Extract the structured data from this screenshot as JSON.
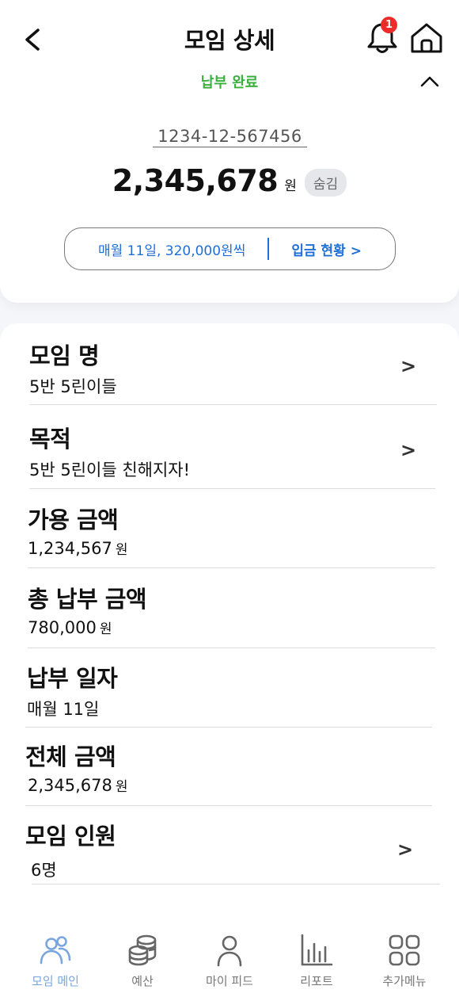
{
  "header": {
    "title": "모임 상세",
    "notification_count": "1",
    "status": "납부 완료"
  },
  "account": {
    "number": "1234-12-567456",
    "balance": "2,345,678",
    "unit": "원",
    "hide_label": "숨김"
  },
  "deposit": {
    "schedule": "매월 11일,  320,000원씩",
    "link_label": "입금 현황  >"
  },
  "info": {
    "group_name": {
      "title": "모임 명",
      "value": "5반 5린이들"
    },
    "purpose": {
      "title": "목적",
      "value": "5반 5린이들 친해지자!"
    },
    "available": {
      "title": "가용 금액",
      "value": "1,234,567",
      "unit": "원"
    },
    "total_paid": {
      "title": "총 납부 금액",
      "value": "780,000",
      "unit": "원"
    },
    "pay_date": {
      "title": "납부 일자",
      "value": "매월 11일"
    },
    "total": {
      "title": "전체 금액",
      "value": "2,345,678",
      "unit": "원"
    },
    "members": {
      "title": "모임 인원",
      "value": "6명"
    },
    "arrow": ">"
  },
  "nav": {
    "items": [
      {
        "label": "모임 메인",
        "icon": "group-icon"
      },
      {
        "label": "예산",
        "icon": "coins-icon"
      },
      {
        "label": "마이 피드",
        "icon": "person-icon"
      },
      {
        "label": "리포트",
        "icon": "bar-chart-icon"
      },
      {
        "label": "추가메뉴",
        "icon": "grid-icon"
      }
    ]
  },
  "colors": {
    "status_green": "#3cb03f",
    "link_blue": "#1f6fd6",
    "active_nav": "#7aa6e0",
    "badge_red": "#ee2b2b"
  }
}
